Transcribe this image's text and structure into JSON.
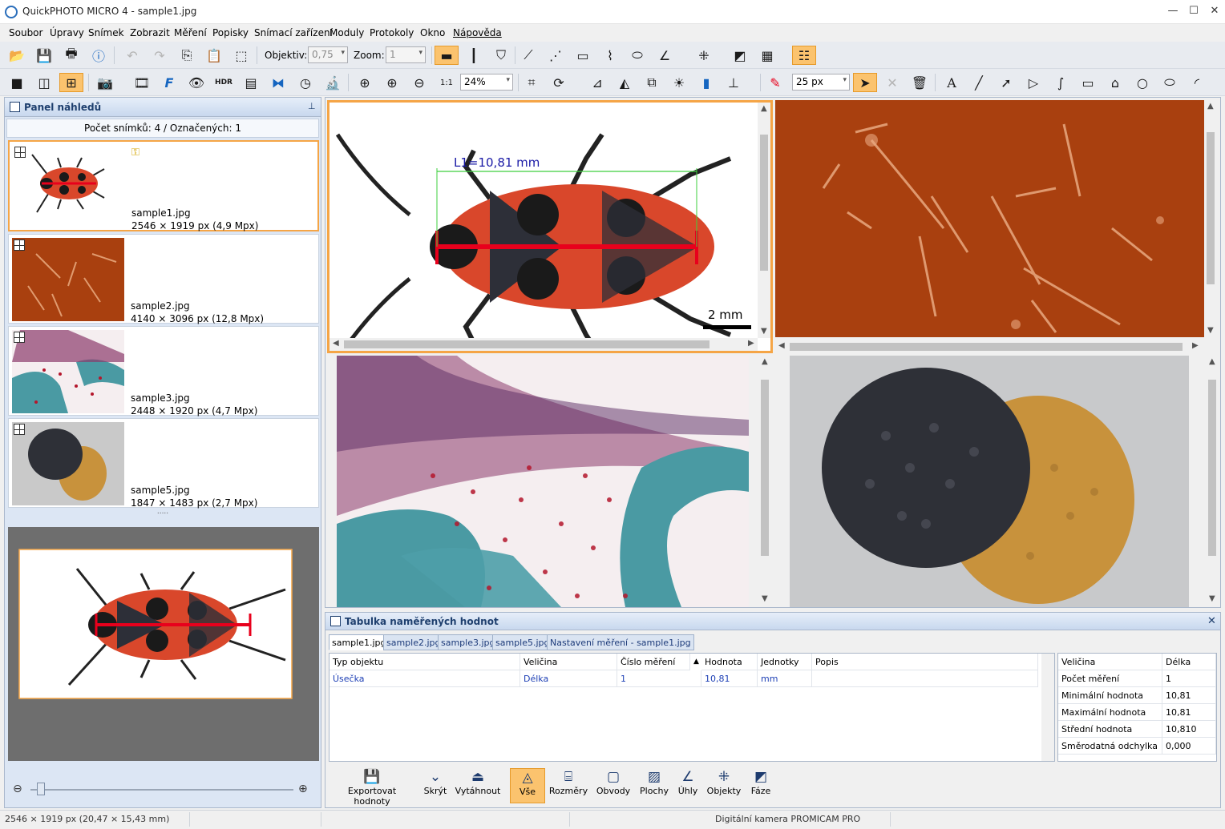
{
  "window": {
    "title": "QuickPHOTO MICRO 4 - sample1.jpg",
    "minimize": "—",
    "maximize": "☐",
    "close": "✕"
  },
  "menu": [
    "Soubor",
    "Úpravy",
    "Snímek",
    "Zobrazit",
    "Měření",
    "Popisky",
    "Snímací zařízení",
    "Moduly",
    "Protokoly",
    "Okno",
    "Nápověda"
  ],
  "toolbar1": {
    "objective_label": "Objektiv:",
    "objective_value": "0,75",
    "zoom_label": "Zoom:",
    "zoom_value": "1"
  },
  "toolbar2": {
    "zoom_percent": "24%",
    "line_width": "25 px"
  },
  "left_panel": {
    "title": "Panel náhledů",
    "count_text": "Počet snímků: 4 / Označených: 1",
    "thumbnails": [
      {
        "name": "sample1.jpg",
        "dims": "2546 × 1919 px (4,9 Mpx)",
        "selected": true
      },
      {
        "name": "sample2.jpg",
        "dims": "4140 × 3096 px (12,8 Mpx)",
        "selected": false
      },
      {
        "name": "sample3.jpg",
        "dims": "2448 × 1920 px (4,7 Mpx)",
        "selected": false
      },
      {
        "name": "sample5.jpg",
        "dims": "1847 × 1483 px (2,7 Mpx)",
        "selected": false
      }
    ],
    "splitter": "....."
  },
  "image_view": {
    "measurement_label": "L1=10,81 mm",
    "scalebar_label": "2 mm"
  },
  "measurement_panel": {
    "title": "Tabulka naměřených hodnot",
    "tabs": [
      "sample1.jpg",
      "sample2.jpg",
      "sample3.jpg",
      "sample5.jpg",
      "Nastavení měření - sample1.jpg"
    ],
    "columns": [
      "Typ objektu",
      "Veličina",
      "Číslo měření",
      "Hodnota",
      "Jednotky",
      "Popis"
    ],
    "sort_indicator": "▲",
    "rows": [
      {
        "type": "Úsečka",
        "quantity": "Délka",
        "number": "1",
        "value": "10,81",
        "unit": "mm",
        "desc": ""
      }
    ],
    "stats": {
      "header": [
        "Veličina",
        "Délka"
      ],
      "rows": [
        [
          "Počet měření",
          "1"
        ],
        [
          "Minimální hodnota",
          "10,81"
        ],
        [
          "Maximální hodnota",
          "10,81"
        ],
        [
          "Střední hodnota",
          "10,810"
        ],
        [
          "Směrodatná odchylka",
          "0,000"
        ]
      ]
    },
    "buttons": [
      "Exportovat hodnoty",
      "Skrýt",
      "Vytáhnout",
      "Vše",
      "Rozměry",
      "Obvody",
      "Plochy",
      "Úhly",
      "Objekty",
      "Fáze"
    ]
  },
  "status_bar": {
    "image_info": "2546 × 1919 px (20,47 × 15,43 mm)",
    "camera": "Digitální kamera PROMICAM PRO"
  },
  "colors": {
    "accent_orange": "#f5a546",
    "measure_red": "#e8001c",
    "measure_green": "#3ecf3e",
    "label_blue": "#1a1aa6"
  }
}
